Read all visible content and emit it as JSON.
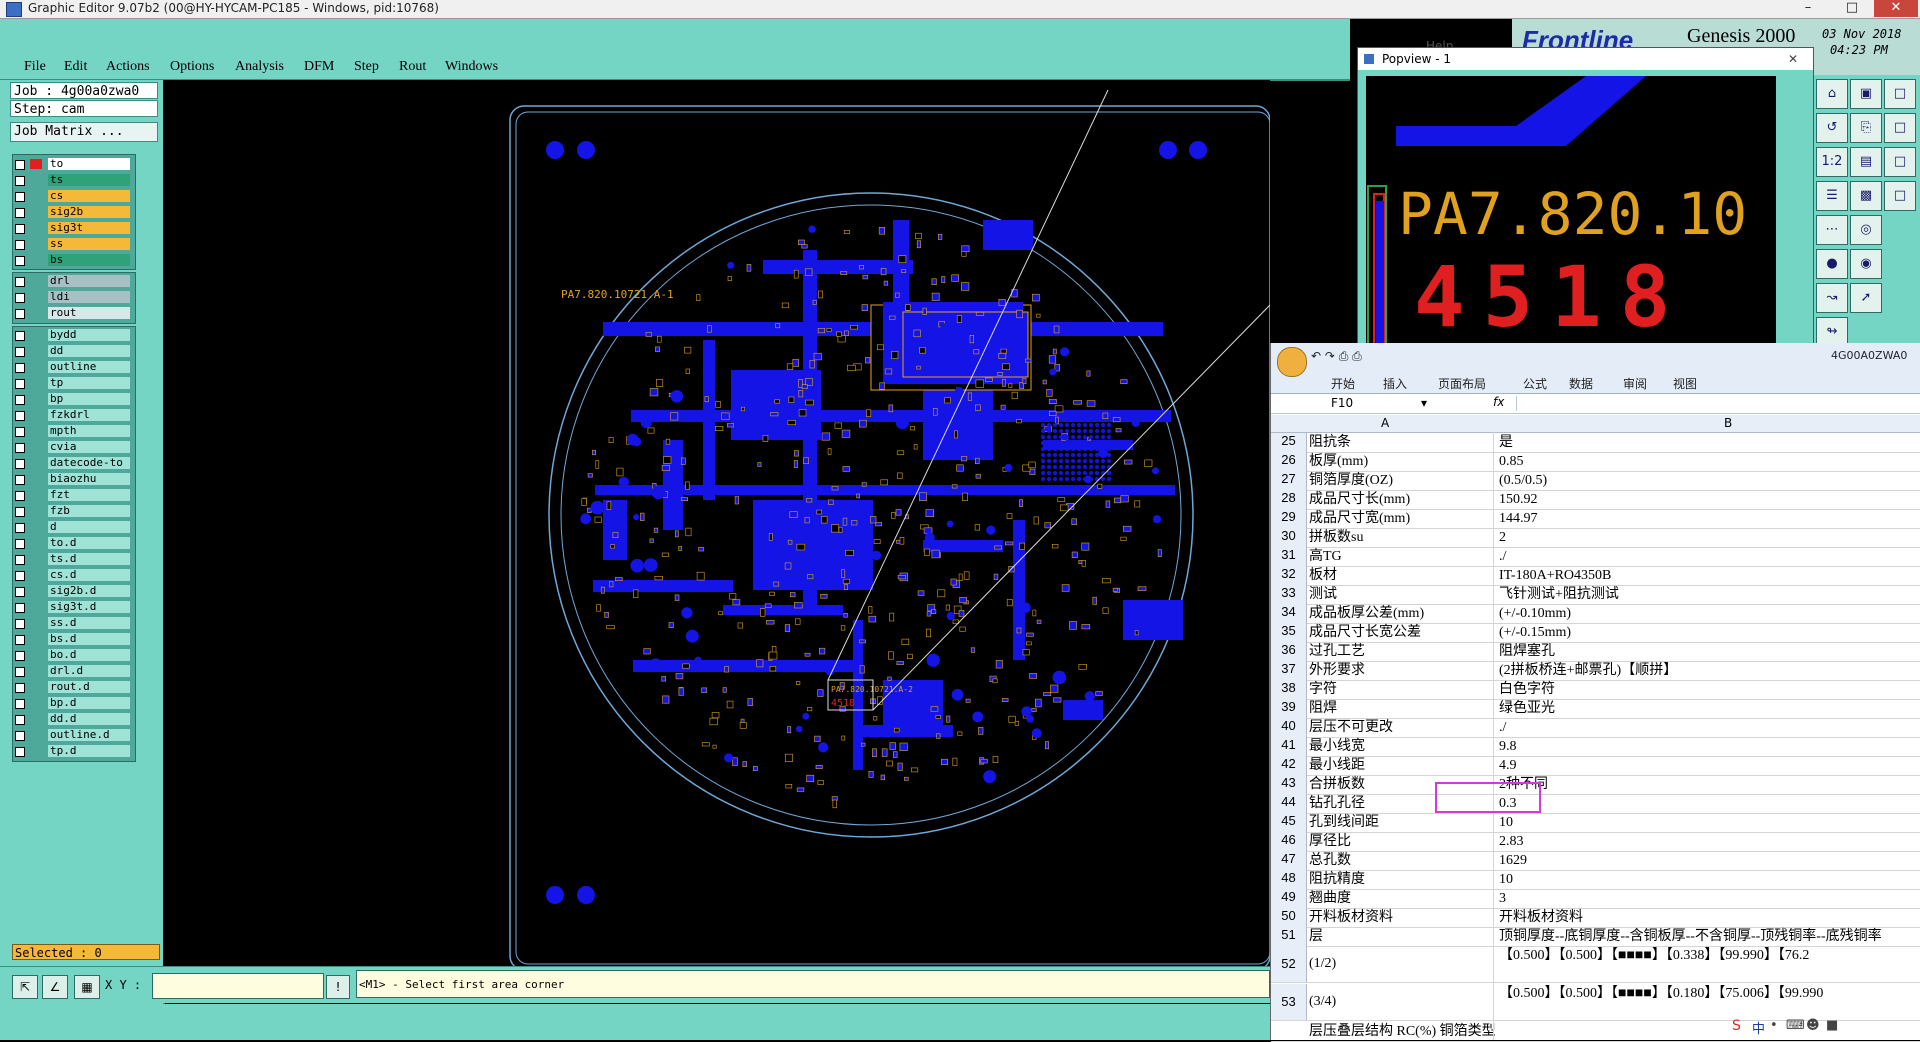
{
  "window": {
    "title": "Graphic Editor 9.07b2 (00@HY-HYCAM-PC185 - Windows, pid:10768)"
  },
  "menu": [
    "File",
    "Edit",
    "Actions",
    "Options",
    "Analysis",
    "DFM",
    "Step",
    "Rout",
    "Windows"
  ],
  "job": {
    "job_label": "Job : 4g00a0zwa0",
    "step_label": "Step: cam",
    "matrix_button": "Job Matrix ..."
  },
  "layers_group1": [
    {
      "name": "to",
      "color": "#ffffff"
    },
    {
      "name": "ts",
      "color": "#2fa27a"
    },
    {
      "name": "cs",
      "color": "#f5b93a"
    },
    {
      "name": "sig2b",
      "color": "#f5b93a"
    },
    {
      "name": "sig3t",
      "color": "#f5b93a"
    },
    {
      "name": "ss",
      "color": "#f5b93a"
    },
    {
      "name": "bs",
      "color": "#2fa27a"
    }
  ],
  "layers_group2": [
    {
      "name": "drl",
      "color": "#a7c0c4"
    },
    {
      "name": "ldi",
      "color": "#a7c0c4"
    },
    {
      "name": "rout",
      "color": "#d8e8e8"
    }
  ],
  "layers_group3": [
    "bydd",
    "dd",
    "outline",
    "tp",
    "bp",
    "fzkdrl",
    "mpth",
    "cvia",
    "datecode-to",
    "biaozhu",
    "fzt",
    "fzb",
    "d",
    "to.d",
    "ts.d",
    "cs.d",
    "sig2b.d",
    "sig3t.d",
    "ss.d",
    "bs.d",
    "bo.d",
    "drl.d",
    "rout.d",
    "bp.d",
    "dd.d",
    "outline.d",
    "tp.d"
  ],
  "selected": "Selected : 0",
  "status": {
    "xy_label": "X Y :",
    "prompt": "<M1> - Select first area corner"
  },
  "board": {
    "silk_label": "PA7.820.10721.A-1",
    "silk_label2": "PA7.820.10721.A-2",
    "code": "4518"
  },
  "genesis": {
    "brand": "Frontline",
    "product": "Genesis 2000",
    "date": "03 Nov 2018",
    "time": "04:23 PM",
    "help": "Help",
    "job_short": "4G00A0ZWA0"
  },
  "popview": {
    "title": "Popview - 1",
    "text_big": "PA7.820.10",
    "text_code": "4518"
  },
  "excel": {
    "tabs": [
      "开始",
      "插入",
      "页面布局",
      "公式",
      "数据",
      "审阅",
      "视图"
    ],
    "cell_ref": "F10",
    "fx": "fx",
    "col_a": "A",
    "col_b": "B",
    "rows": [
      {
        "n": "25",
        "a": "阻抗条",
        "b": "是"
      },
      {
        "n": "26",
        "a": "板厚(mm)",
        "b": "0.85"
      },
      {
        "n": "27",
        "a": "铜箔厚度(OZ)",
        "b": "(0.5/0.5)"
      },
      {
        "n": "28",
        "a": "成品尺寸长(mm)",
        "b": "150.92"
      },
      {
        "n": "29",
        "a": "成品尺寸宽(mm)",
        "b": "144.97"
      },
      {
        "n": "30",
        "a": "拼板数su",
        "b": "2"
      },
      {
        "n": "31",
        "a": "高TG",
        "b": "./"
      },
      {
        "n": "32",
        "a": "板材",
        "b": "IT-180A+RO4350B"
      },
      {
        "n": "33",
        "a": "测试",
        "b": "飞针测试+阻抗测试"
      },
      {
        "n": "34",
        "a": "成品板厚公差(mm)",
        "b": "(+/-0.10mm)"
      },
      {
        "n": "35",
        "a": "成品尺寸长宽公差",
        "b": "(+/-0.15mm)"
      },
      {
        "n": "36",
        "a": "过孔工艺",
        "b": "阻焊塞孔"
      },
      {
        "n": "37",
        "a": "外形要求",
        "b": "(2拼板桥连+邮票孔)【顺拼】"
      },
      {
        "n": "38",
        "a": "字符",
        "b": "白色字符"
      },
      {
        "n": "39",
        "a": "阻焊",
        "b": "绿色亚光"
      },
      {
        "n": "40",
        "a": "层压不可更改",
        "b": "./"
      },
      {
        "n": "41",
        "a": "最小线宽",
        "b": "9.8"
      },
      {
        "n": "42",
        "a": "最小线距",
        "b": "4.9"
      },
      {
        "n": "43",
        "a": "合拼板数",
        "b": "2种不同"
      },
      {
        "n": "44",
        "a": "钻孔孔径",
        "b": "0.3"
      },
      {
        "n": "45",
        "a": "孔到线间距",
        "b": "10"
      },
      {
        "n": "46",
        "a": "厚径比",
        "b": "2.83"
      },
      {
        "n": "47",
        "a": "总孔数",
        "b": "1629"
      },
      {
        "n": "48",
        "a": "阻抗精度",
        "b": "10"
      },
      {
        "n": "49",
        "a": "翘曲度",
        "b": "3"
      },
      {
        "n": "50",
        "a": "开料板材资料",
        "b": "开料板材资料"
      },
      {
        "n": "51",
        "a": "层",
        "b": "顶铜厚度--底铜厚度--含铜板厚--不含铜厚--顶残铜率--底残铜率"
      }
    ],
    "tall_rows": [
      {
        "n": "52",
        "a": "(1/2)",
        "b": "【0.500】【0.500】【■■■■】【0.338】【99.990】【76.2"
      },
      {
        "n": "53",
        "a": "(3/4)",
        "b": "【0.500】【0.500】【■■■■】【0.180】【75.006】【99.990"
      }
    ],
    "last_row": "层压叠层结构   RC(%)  铜箔类型"
  },
  "colors": {
    "panel": "#74d5c5",
    "copper": "#1414e6",
    "silk": "#e0a21e",
    "outline": "#6fa8d8"
  }
}
